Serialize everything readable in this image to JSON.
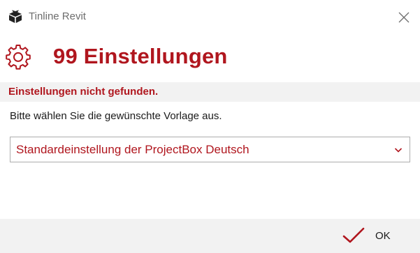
{
  "window": {
    "title": "Tinline Revit",
    "app_icon": "box-icon",
    "close_icon": "close-icon"
  },
  "header": {
    "icon": "gear-icon",
    "title": "99 Einstellungen"
  },
  "message": {
    "error": "Einstellungen nicht gefunden.",
    "instruction": "Bitte wählen Sie die gewünschte Vorlage aus."
  },
  "template_select": {
    "selected": "Standardeinstellung der ProjectBox Deutsch",
    "icon": "chevron-down-icon"
  },
  "footer": {
    "ok_label": "OK",
    "ok_icon": "checkmark-icon"
  },
  "colors": {
    "accent": "#b0161e",
    "band": "#f2f2f2",
    "text": "#1a1a1a",
    "muted": "#6e6e6e"
  }
}
